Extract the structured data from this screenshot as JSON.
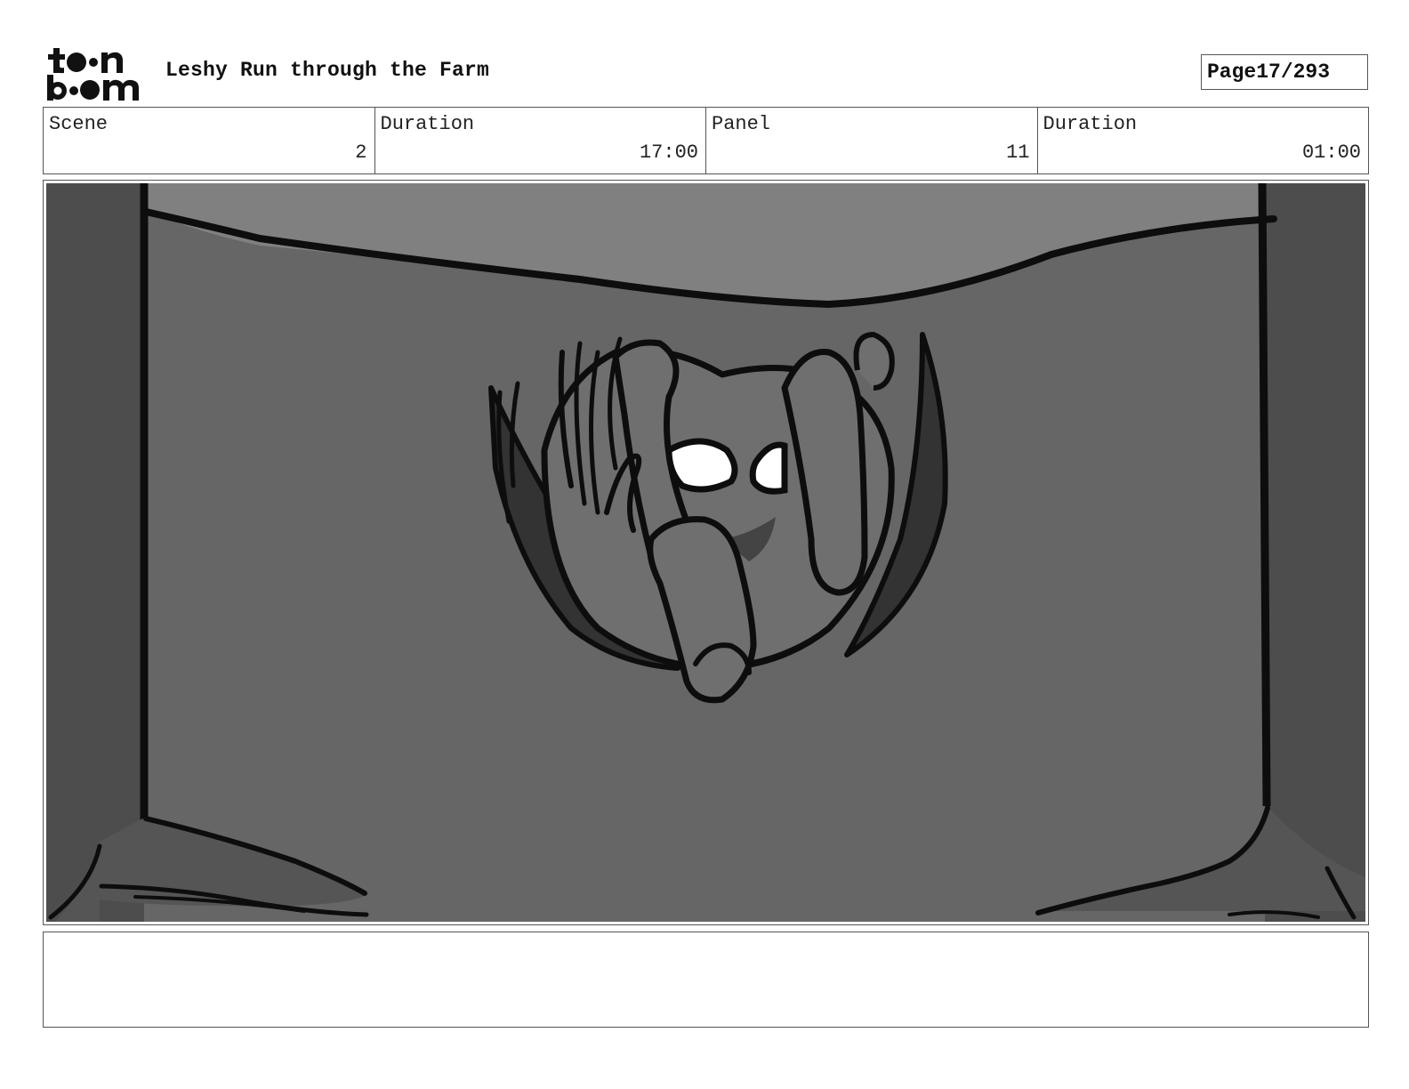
{
  "header": {
    "logo_text": "toon boom",
    "title": "Leshy Run through the Farm",
    "page_label": "Page",
    "page_value": "17/293"
  },
  "info": {
    "scene_label": "Scene",
    "scene_value": "2",
    "scene_duration_label": "Duration",
    "scene_duration_value": "17:00",
    "panel_label": "Panel",
    "panel_value": "11",
    "panel_duration_label": "Duration",
    "panel_duration_value": "01:00"
  },
  "notes": {
    "text": ""
  }
}
